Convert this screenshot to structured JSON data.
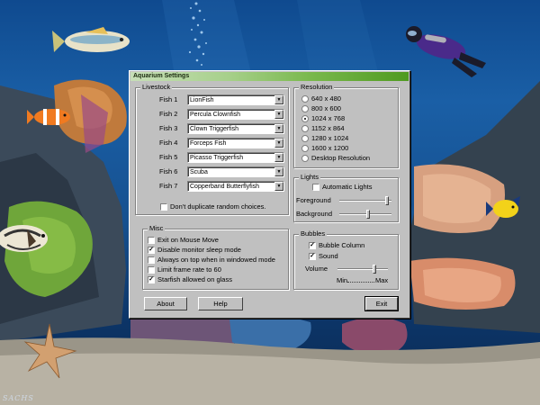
{
  "window": {
    "title": "Aquarium Settings"
  },
  "livestock": {
    "title": "Livestock",
    "fish": [
      {
        "label": "Fish 1",
        "value": "LionFish"
      },
      {
        "label": "Fish 2",
        "value": "Percula Clownfish"
      },
      {
        "label": "Fish 3",
        "value": "Clown Triggerfish"
      },
      {
        "label": "Fish 4",
        "value": "Forceps Fish"
      },
      {
        "label": "Fish 5",
        "value": "Picasso Triggerfish"
      },
      {
        "label": "Fish 6",
        "value": "Scuba"
      },
      {
        "label": "Fish 7",
        "value": "Copperband Butterflyfish"
      }
    ],
    "no_duplicates": {
      "label": "Don't duplicate random choices.",
      "checked": false
    }
  },
  "resolution": {
    "title": "Resolution",
    "options": [
      {
        "label": "640 x 480",
        "selected": false
      },
      {
        "label": "800 x 600",
        "selected": false
      },
      {
        "label": "1024 x 768",
        "selected": true
      },
      {
        "label": "1152 x 864",
        "selected": false
      },
      {
        "label": "1280 x 1024",
        "selected": false
      },
      {
        "label": "1600 x 1200",
        "selected": false
      },
      {
        "label": "Desktop Resolution",
        "selected": false
      }
    ]
  },
  "lights": {
    "title": "Lights",
    "automatic": {
      "label": "Automatic Lights",
      "checked": false
    },
    "foreground": {
      "label": "Foreground",
      "level": 0.95
    },
    "background": {
      "label": "Background",
      "level": 0.55
    }
  },
  "misc": {
    "title": "Misc",
    "options": [
      {
        "label": "Exit on Mouse Move",
        "checked": false
      },
      {
        "label": "Disable monitor sleep mode",
        "checked": true
      },
      {
        "label": "Always on top when in windowed mode",
        "checked": false
      },
      {
        "label": "Limit frame rate to 60",
        "checked": false
      },
      {
        "label": "Starfish allowed on glass",
        "checked": true
      }
    ]
  },
  "bubbles": {
    "title": "Bubbles",
    "bubble_column": {
      "label": "Bubble Column",
      "checked": true
    },
    "sound": {
      "label": "Sound",
      "checked": true
    },
    "volume": {
      "label": "Volume",
      "min_label": "Min",
      "max_label": "Max",
      "level": 0.75
    }
  },
  "buttons": {
    "about": "About",
    "help": "Help",
    "exit": "Exit"
  },
  "watermark": "SACHS",
  "colors": {
    "dialog_bg": "#c0c0c0",
    "title_gradient_end": "#4f9a20",
    "water": "#1a5fa6"
  }
}
